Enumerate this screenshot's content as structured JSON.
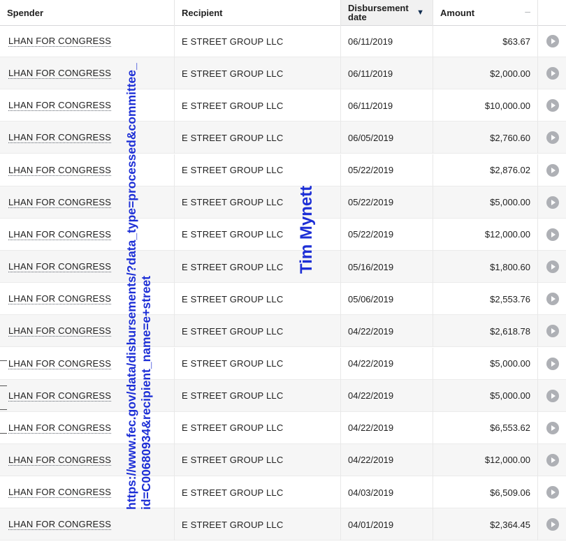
{
  "columns": {
    "spender": "Spender",
    "recipient": "Recipient",
    "date_line1": "Disbursement",
    "date_line2": "date",
    "amount": "Amount",
    "amount_control": "–"
  },
  "rows": [
    {
      "spender": "LHAN FOR CONGRESS",
      "recipient": "E STREET GROUP LLC",
      "date": "06/11/2019",
      "amount": "$63.67"
    },
    {
      "spender": "LHAN FOR CONGRESS",
      "recipient": "E STREET GROUP LLC",
      "date": "06/11/2019",
      "amount": "$2,000.00"
    },
    {
      "spender": "LHAN FOR CONGRESS",
      "recipient": "E STREET GROUP LLC",
      "date": "06/11/2019",
      "amount": "$10,000.00"
    },
    {
      "spender": "LHAN FOR CONGRESS",
      "recipient": "E STREET GROUP LLC",
      "date": "06/05/2019",
      "amount": "$2,760.60"
    },
    {
      "spender": "LHAN FOR CONGRESS",
      "recipient": "E STREET GROUP LLC",
      "date": "05/22/2019",
      "amount": "$2,876.02"
    },
    {
      "spender": "LHAN FOR CONGRESS",
      "recipient": "E STREET GROUP LLC",
      "date": "05/22/2019",
      "amount": "$5,000.00"
    },
    {
      "spender": "LHAN FOR CONGRESS",
      "recipient": "E STREET GROUP LLC",
      "date": "05/22/2019",
      "amount": "$12,000.00"
    },
    {
      "spender": "LHAN FOR CONGRESS",
      "recipient": "E STREET GROUP LLC",
      "date": "05/16/2019",
      "amount": "$1,800.60"
    },
    {
      "spender": "LHAN FOR CONGRESS",
      "recipient": "E STREET GROUP LLC",
      "date": "05/06/2019",
      "amount": "$2,553.76"
    },
    {
      "spender": "LHAN FOR CONGRESS",
      "recipient": "E STREET GROUP LLC",
      "date": "04/22/2019",
      "amount": "$2,618.78"
    },
    {
      "spender": "LHAN FOR CONGRESS",
      "recipient": "E STREET GROUP LLC",
      "date": "04/22/2019",
      "amount": "$5,000.00"
    },
    {
      "spender": "LHAN FOR CONGRESS",
      "recipient": "E STREET GROUP LLC",
      "date": "04/22/2019",
      "amount": "$5,000.00"
    },
    {
      "spender": "LHAN FOR CONGRESS",
      "recipient": "E STREET GROUP LLC",
      "date": "04/22/2019",
      "amount": "$6,553.62"
    },
    {
      "spender": "LHAN FOR CONGRESS",
      "recipient": "E STREET GROUP LLC",
      "date": "04/22/2019",
      "amount": "$12,000.00"
    },
    {
      "spender": "LHAN FOR CONGRESS",
      "recipient": "E STREET GROUP LLC",
      "date": "04/03/2019",
      "amount": "$6,509.06"
    },
    {
      "spender": "LHAN FOR CONGRESS",
      "recipient": "E STREET GROUP LLC",
      "date": "04/01/2019",
      "amount": "$2,364.45"
    }
  ],
  "row_action_icon": "play-circle-icon",
  "sort_icon": "sort-descending-icon",
  "overlay": {
    "url_line1": "https://www.fec.gov/data/disbursements/?data_type=processed&committee_",
    "url_line2": "id=C00680934&recipient_name=e+street",
    "name": "Tim Mynett",
    "color": "#1d2fd6"
  },
  "colors": {
    "header_sorted_bg": "#f1f1f1",
    "alt_row_bg": "#f6f6f6",
    "icon_gray": "#aeb0b5"
  }
}
